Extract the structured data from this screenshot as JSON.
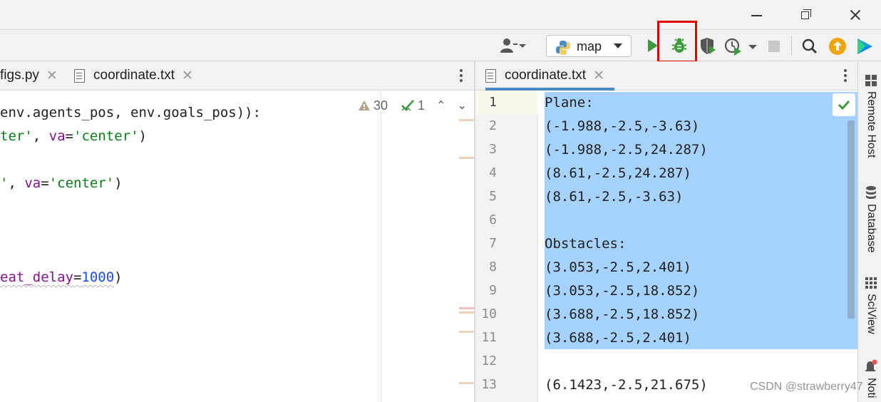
{
  "toolbar": {
    "run_config_label": "map"
  },
  "tabs_left": [
    {
      "label": "figs.py",
      "close": "✕"
    },
    {
      "label": "coordinate.txt",
      "close": "✕"
    }
  ],
  "tabs_right": [
    {
      "label": "coordinate.txt",
      "close": "✕"
    }
  ],
  "left_editor": {
    "lines": [
      "env.agents_pos, env.goals_pos)):",
      "ter', va='center')",
      "', va='center')",
      "eat_delay=1000)"
    ],
    "warnings_count": "30",
    "weak_warnings_count": "1"
  },
  "right_editor": {
    "line_numbers": [
      "1",
      "2",
      "3",
      "4",
      "5",
      "6",
      "7",
      "8",
      "9",
      "10",
      "11",
      "12",
      "13"
    ],
    "lines": [
      "Plane:",
      "(-1.988,-2.5,-3.63)",
      "(-1.988,-2.5,24.287)",
      "(8.61,-2.5,24.287)",
      "(8.61,-2.5,-3.63)",
      "",
      "Obstacles:",
      "(3.053,-2.5,2.401)",
      "(3.053,-2.5,18.852)",
      "(3.688,-2.5,18.852)",
      "(3.688,-2.5,2.401)",
      "",
      "(6.1423,-2.5,21.675)"
    ]
  },
  "tool_windows": [
    {
      "label": "Remote Host",
      "icon": "remote-host-icon"
    },
    {
      "label": "Database",
      "icon": "database-icon"
    },
    {
      "label": "SciView",
      "icon": "sciview-icon"
    },
    {
      "label": "Noti",
      "icon": "notifications-icon"
    }
  ],
  "watermark": "CSDN @strawberry47",
  "colors": {
    "selection": "#a6d2ff",
    "highlight_box": "#e60000",
    "run_green": "#3d9a3d",
    "update_orange": "#f0a30a"
  }
}
